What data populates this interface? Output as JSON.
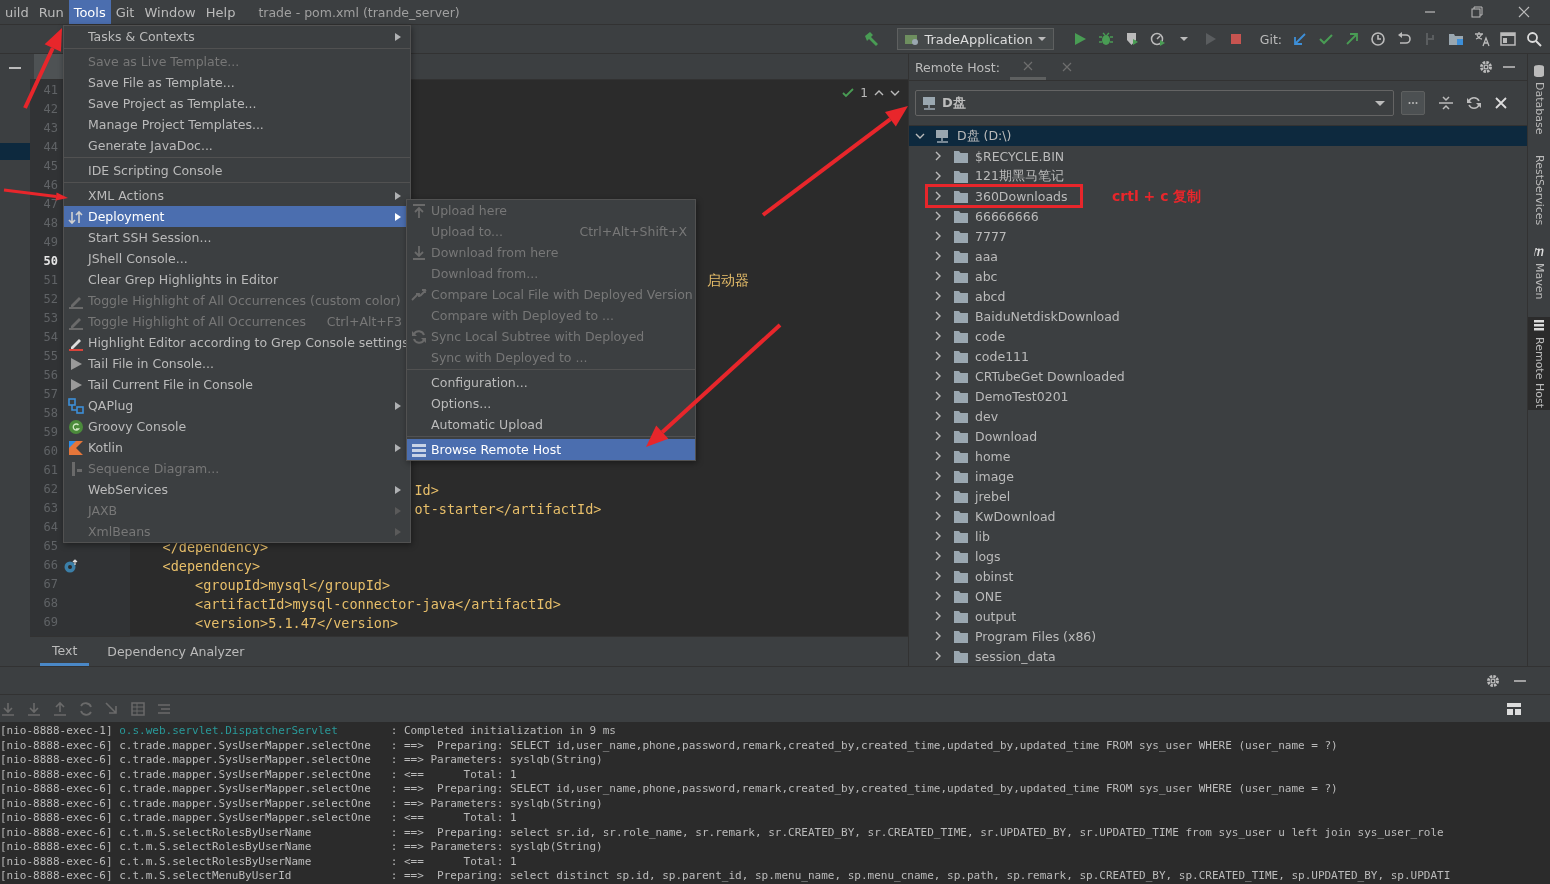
{
  "menu_bar": {
    "items": [
      {
        "label": "uild",
        "selected": false
      },
      {
        "label": "Run",
        "selected": false
      },
      {
        "label": "Tools",
        "selected": true
      },
      {
        "label": "Git",
        "selected": false
      },
      {
        "label": "Window",
        "selected": false
      },
      {
        "label": "Help",
        "selected": false
      }
    ],
    "title": "trade - pom.xml (trande_server)"
  },
  "toolbar": {
    "run_config": "TradeApplication",
    "git_label": "Git:"
  },
  "editor": {
    "inspection_count": "1",
    "lines": [
      {
        "number": "41",
        "current": false
      },
      {
        "number": "42",
        "current": false
      },
      {
        "number": "43",
        "current": false
      },
      {
        "number": "44",
        "current": false
      },
      {
        "number": "45",
        "current": false
      },
      {
        "number": "46",
        "current": false
      },
      {
        "number": "47",
        "current": false
      },
      {
        "number": "48",
        "current": false
      },
      {
        "number": "49",
        "current": false
      },
      {
        "number": "50",
        "current": true
      },
      {
        "number": "51",
        "current": false,
        "text": "                                                                       启动器"
      },
      {
        "number": "52",
        "current": false
      },
      {
        "number": "53",
        "current": false
      },
      {
        "number": "54",
        "current": false
      },
      {
        "number": "55",
        "current": false
      },
      {
        "number": "56",
        "current": false
      },
      {
        "number": "57",
        "current": false
      },
      {
        "number": "58",
        "current": false
      },
      {
        "number": "59",
        "current": false
      },
      {
        "number": "60",
        "current": false
      },
      {
        "number": "61",
        "current": false
      },
      {
        "number": "62",
        "current": false,
        "text": "                                   Id>"
      },
      {
        "number": "63",
        "current": false,
        "text": "                                   ot-starter</artifactId>"
      },
      {
        "number": "64",
        "current": false
      },
      {
        "number": "65",
        "current": false,
        "text": "    </dependency>"
      },
      {
        "number": "66",
        "current": false,
        "text": "    <dependency>",
        "gutter_icon": true
      },
      {
        "number": "67",
        "current": false,
        "text": "        <groupId>mysql</groupId>"
      },
      {
        "number": "68",
        "current": false,
        "text": "        <artifactId>mysql-connector-java</artifactId>"
      },
      {
        "number": "69",
        "current": false,
        "text": "        <version>5.1.47</version>"
      }
    ],
    "bottom_tabs": [
      {
        "label": "Text",
        "selected": true
      },
      {
        "label": "Dependency Analyzer",
        "selected": false
      }
    ]
  },
  "tools_menu": [
    {
      "kind": "item",
      "label": "Tasks & Contexts",
      "submenu": true,
      "disabled": false,
      "selected": false
    },
    {
      "kind": "separator"
    },
    {
      "kind": "item",
      "label": "Save as Live Template...",
      "submenu": false,
      "disabled": true,
      "selected": false
    },
    {
      "kind": "item",
      "label": "Save File as Template...",
      "submenu": false,
      "disabled": false,
      "selected": false
    },
    {
      "kind": "item",
      "label": "Save Project as Template...",
      "submenu": false,
      "disabled": false,
      "selected": false
    },
    {
      "kind": "item",
      "label": "Manage Project Templates...",
      "submenu": false,
      "disabled": false,
      "selected": false
    },
    {
      "kind": "item",
      "label": "Generate JavaDoc...",
      "submenu": false,
      "disabled": false,
      "selected": false
    },
    {
      "kind": "separator"
    },
    {
      "kind": "item",
      "label": "IDE Scripting Console",
      "submenu": false,
      "disabled": false,
      "selected": false
    },
    {
      "kind": "separator"
    },
    {
      "kind": "item",
      "label": "XML Actions",
      "submenu": true,
      "disabled": false,
      "selected": false
    },
    {
      "label": "Deployment",
      "submenu": true,
      "disabled": false,
      "selected": true,
      "kind": "deploy"
    },
    {
      "kind": "item",
      "label": "Start SSH Session...",
      "submenu": false,
      "disabled": false,
      "selected": false
    },
    {
      "kind": "item",
      "label": "JShell Console...",
      "submenu": false,
      "disabled": false,
      "selected": false
    },
    {
      "kind": "item",
      "label": "Clear Grep Highlights in Editor",
      "submenu": false,
      "disabled": false,
      "selected": false
    },
    {
      "kind": "pencil",
      "label": "Toggle Highlight of All Occurrences (custom color)",
      "submenu": false,
      "disabled": true,
      "selected": false
    },
    {
      "kind": "pencil",
      "label": "Toggle Highlight of All Occurrences",
      "shortcut": "Ctrl+Alt+F3",
      "submenu": false,
      "disabled": true,
      "selected": false
    },
    {
      "kind": "pencil-red",
      "label": "Highlight Editor according to Grep Console settings",
      "submenu": false,
      "disabled": false,
      "selected": false
    },
    {
      "kind": "play",
      "label": "Tail File in Console...",
      "submenu": false,
      "disabled": false,
      "selected": false
    },
    {
      "kind": "play",
      "label": "Tail Current File in Console",
      "submenu": false,
      "disabled": false,
      "selected": false
    },
    {
      "kind": "blocks",
      "label": "QAPlug",
      "submenu": true,
      "disabled": false,
      "selected": false
    },
    {
      "kind": "groovy",
      "label": "Groovy Console",
      "submenu": false,
      "disabled": false,
      "selected": false
    },
    {
      "kind": "kotlin",
      "label": "Kotlin",
      "submenu": true,
      "disabled": false,
      "selected": false
    },
    {
      "kind": "sequence",
      "label": "Sequence Diagram...",
      "submenu": false,
      "disabled": true,
      "selected": false
    },
    {
      "kind": "item",
      "label": "WebServices",
      "submenu": true,
      "disabled": false,
      "selected": false
    },
    {
      "kind": "item",
      "label": "JAXB",
      "submenu": true,
      "disabled": true,
      "selected": false
    },
    {
      "kind": "item",
      "label": "XmlBeans",
      "submenu": true,
      "disabled": true,
      "selected": false
    }
  ],
  "deployment_menu": [
    {
      "kind": "upload",
      "label": "Upload here",
      "disabled": true,
      "selected": false
    },
    {
      "kind": "item",
      "label": "Upload to...",
      "shortcut": "Ctrl+Alt+Shift+X",
      "disabled": true,
      "selected": false
    },
    {
      "kind": "download",
      "label": "Download from here",
      "disabled": true,
      "selected": false
    },
    {
      "kind": "item",
      "label": "Download from...",
      "disabled": true,
      "selected": false
    },
    {
      "kind": "compare",
      "label": "Compare Local File with Deployed Version",
      "disabled": true,
      "selected": false
    },
    {
      "kind": "item",
      "label": "Compare with Deployed to ...",
      "disabled": true,
      "selected": false
    },
    {
      "kind": "sync",
      "label": "Sync Local Subtree with Deployed",
      "disabled": true,
      "selected": false
    },
    {
      "kind": "item",
      "label": "Sync with Deployed to ...",
      "disabled": true,
      "selected": false
    },
    {
      "kind": "separator"
    },
    {
      "kind": "item",
      "label": "Configuration...",
      "disabled": false,
      "selected": false
    },
    {
      "kind": "item",
      "label": "Options...",
      "disabled": false,
      "selected": false
    },
    {
      "kind": "item",
      "label": "Automatic Upload",
      "disabled": false,
      "selected": false
    },
    {
      "kind": "separator"
    },
    {
      "kind": "server",
      "label": "Browse Remote Host",
      "disabled": false,
      "selected": true
    }
  ],
  "remote_host": {
    "title": "Remote Host:",
    "server": "D盘",
    "tree": [
      {
        "label": "D盘 (D:\\)",
        "expanded": true,
        "selected": true,
        "children": [
          {
            "label": "$RECYCLE.BIN",
            "expanded": false,
            "selected": false
          },
          {
            "label": "121期黑马笔记",
            "expanded": false,
            "selected": false
          },
          {
            "label": "360Downloads",
            "expanded": false,
            "selected": false,
            "framed": true,
            "note": "crtl + c 复制"
          },
          {
            "label": "66666666",
            "expanded": false,
            "selected": false
          },
          {
            "label": "7777",
            "expanded": false,
            "selected": false
          },
          {
            "label": "aaa",
            "expanded": false,
            "selected": false
          },
          {
            "label": "abc",
            "expanded": false,
            "selected": false
          },
          {
            "label": "abcd",
            "expanded": false,
            "selected": false
          },
          {
            "label": "BaiduNetdiskDownload",
            "expanded": false,
            "selected": false
          },
          {
            "label": "code",
            "expanded": false,
            "selected": false
          },
          {
            "label": "code111",
            "expanded": false,
            "selected": false
          },
          {
            "label": "CRTubeGet Downloaded",
            "expanded": false,
            "selected": false
          },
          {
            "label": "DemoTest0201",
            "expanded": false,
            "selected": false
          },
          {
            "label": "dev",
            "expanded": false,
            "selected": false
          },
          {
            "label": "Download",
            "expanded": false,
            "selected": false
          },
          {
            "label": "home",
            "expanded": false,
            "selected": false
          },
          {
            "label": "image",
            "expanded": false,
            "selected": false
          },
          {
            "label": "jrebel",
            "expanded": false,
            "selected": false
          },
          {
            "label": "KwDownload",
            "expanded": false,
            "selected": false
          },
          {
            "label": "lib",
            "expanded": false,
            "selected": false
          },
          {
            "label": "logs",
            "expanded": false,
            "selected": false
          },
          {
            "label": "obinst",
            "expanded": false,
            "selected": false
          },
          {
            "label": "ONE",
            "expanded": false,
            "selected": false
          },
          {
            "label": "output",
            "expanded": false,
            "selected": false
          },
          {
            "label": "Program Files (x86)",
            "expanded": false,
            "selected": false
          },
          {
            "label": "session_data",
            "expanded": false,
            "selected": false
          }
        ]
      }
    ]
  },
  "side_tabs": [
    {
      "label": "Database",
      "selected": false
    },
    {
      "label": "RestServices",
      "selected": false
    },
    {
      "label": "Maven",
      "selected": false
    },
    {
      "label": "Remote Host",
      "selected": true
    }
  ],
  "console": [
    {
      "thread": "[nio-8888-exec-1]",
      "logger": "o.s.web.servlet.DispatcherServlet",
      "color": "#299999",
      "message": ": Completed initialization in 9 ms"
    },
    {
      "thread": "[nio-8888-exec-6]",
      "logger": "c.trade.mapper.SysUserMapper.selectOne",
      "color": "#bbbbbb",
      "message": ": ==>  Preparing: SELECT id,user_name,phone,password,remark,created_by,created_time,updated_by,updated_time FROM sys_user WHERE (user_name = ?)"
    },
    {
      "thread": "[nio-8888-exec-6]",
      "logger": "c.trade.mapper.SysUserMapper.selectOne",
      "color": "#bbbbbb",
      "message": ": ==> Parameters: syslqb(String)"
    },
    {
      "thread": "[nio-8888-exec-6]",
      "logger": "c.trade.mapper.SysUserMapper.selectOne",
      "color": "#bbbbbb",
      "message": ": <==      Total: 1"
    },
    {
      "thread": "[nio-8888-exec-6]",
      "logger": "c.trade.mapper.SysUserMapper.selectOne",
      "color": "#bbbbbb",
      "message": ": ==>  Preparing: SELECT id,user_name,phone,password,remark,created_by,created_time,updated_by,updated_time FROM sys_user WHERE (user_name = ?)"
    },
    {
      "thread": "[nio-8888-exec-6]",
      "logger": "c.trade.mapper.SysUserMapper.selectOne",
      "color": "#bbbbbb",
      "message": ": ==> Parameters: syslqb(String)"
    },
    {
      "thread": "[nio-8888-exec-6]",
      "logger": "c.trade.mapper.SysUserMapper.selectOne",
      "color": "#bbbbbb",
      "message": ": <==      Total: 1"
    },
    {
      "thread": "[nio-8888-exec-6]",
      "logger": "c.t.m.S.selectRolesByUserName",
      "color": "#bbbbbb",
      "message": ": ==>  Preparing: select sr.id, sr.role_name, sr.remark, sr.CREATED_BY, sr.CREATED_TIME, sr.UPDATED_BY, sr.UPDATED_TIME from sys_user u left join sys_user_role"
    },
    {
      "thread": "[nio-8888-exec-6]",
      "logger": "c.t.m.S.selectRolesByUserName",
      "color": "#bbbbbb",
      "message": ": ==> Parameters: syslqb(String)"
    },
    {
      "thread": "[nio-8888-exec-6]",
      "logger": "c.t.m.S.selectRolesByUserName",
      "color": "#bbbbbb",
      "message": ": <==      Total: 1"
    },
    {
      "thread": "[nio-8888-exec-6]",
      "logger": "c.t.m.S.selectMenuByUserId",
      "color": "#bbbbbb",
      "message": ": ==>  Preparing: select distinct sp.id, sp.parent_id, sp.menu_name, sp.menu_cname, sp.path, sp.remark, sp.CREATED_BY, sp.CREATED_TIME, sp.UPDATED_BY, sp.UPDATI"
    }
  ]
}
